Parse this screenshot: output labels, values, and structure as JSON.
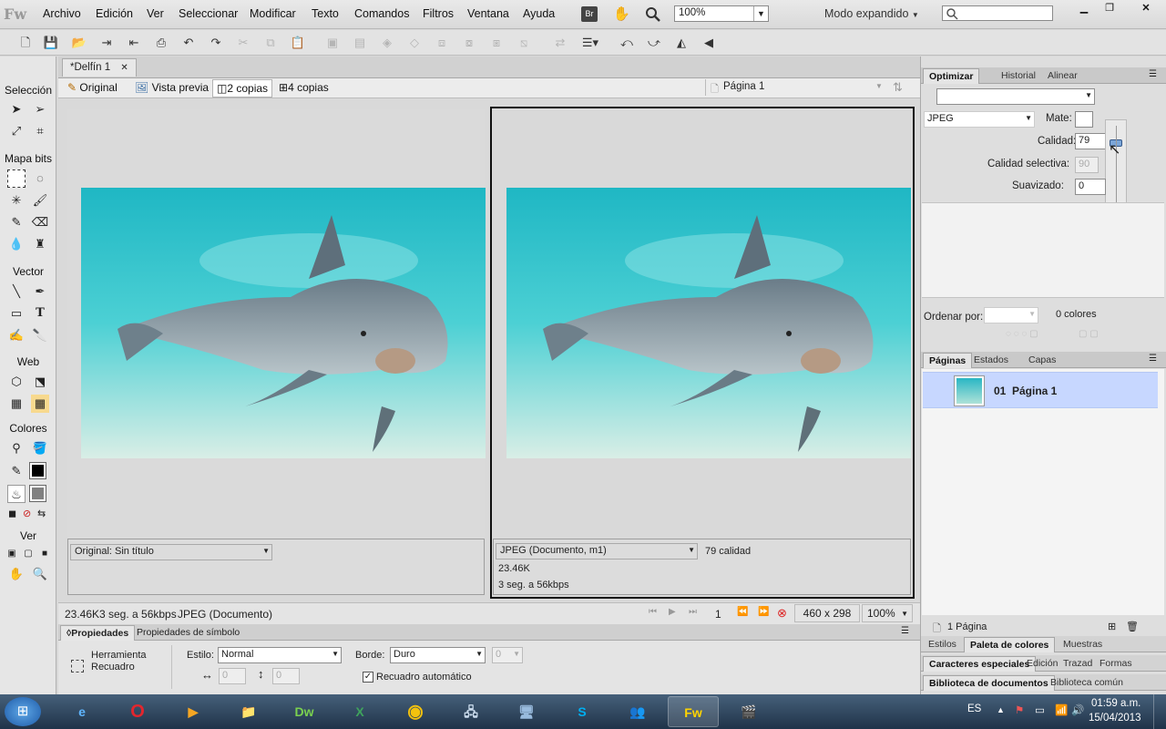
{
  "app": {
    "logo": "Fw"
  },
  "menu": [
    "Archivo",
    "Edición",
    "Ver",
    "Seleccionar",
    "Modificar",
    "Texto",
    "Comandos",
    "Filtros",
    "Ventana",
    "Ayuda"
  ],
  "menubar": {
    "bridge_label": "Br",
    "zoom": "100%",
    "workspace": "Modo expandido"
  },
  "document": {
    "tab_title": "*Delfín 1"
  },
  "view_tabs": {
    "original": "Original",
    "preview": "Vista previa",
    "two_up": "2 copias",
    "four_up": "4 copias",
    "page": "Página 1"
  },
  "tools": {
    "selection": "Selección",
    "bitmap": "Mapa bits",
    "vector": "Vector",
    "web": "Web",
    "colors": "Colores",
    "view": "Ver",
    "stroke_color": "#000000",
    "fill_color": "#808080"
  },
  "left_pane": {
    "format": "Original: Sin título"
  },
  "right_pane": {
    "format": "JPEG (Documento, m1)",
    "quality": "79 calidad",
    "size": "23.46K",
    "time": "3 seg. a 56kbps"
  },
  "status": {
    "size": "23.46K",
    "time": "3 seg. a 56kbps",
    "format": "JPEG (Documento)",
    "page_num": "1",
    "dimensions": "460 x 298",
    "zoom": "100%"
  },
  "properties": {
    "tab1": "Propiedades",
    "tab2": "Propiedades de símbolo",
    "tool_name1": "Herramienta",
    "tool_name2": "Recuadro",
    "style_label": "Estilo:",
    "style_value": "Normal",
    "edge_label": "Borde:",
    "edge_value": "Duro",
    "edge_amount": "0",
    "width": "0",
    "height": "0",
    "auto_crop": "Recuadro automático"
  },
  "optimize": {
    "tabs": [
      "Optimizar",
      "Historial",
      "Alinear"
    ],
    "preset": "",
    "format": "JPEG",
    "matte_label": "Mate:",
    "quality_label": "Calidad:",
    "quality": "79",
    "selective_label": "Calidad selectiva:",
    "selective": "90",
    "smoothing_label": "Suavizado:",
    "smoothing": "0",
    "sort_label": "Ordenar por:",
    "sort_value": "",
    "colors": "0 colores"
  },
  "pages_panel": {
    "tabs": [
      "Páginas",
      "Estados",
      "Capas"
    ],
    "page_number": "01",
    "page_name": "Página 1",
    "count": "1 Página"
  },
  "bottom_panels": {
    "row1": [
      "Estilos",
      "Paleta de colores",
      "Muestras"
    ],
    "row2": [
      "Caracteres especiales",
      "Edición",
      "Trazad",
      "Formas"
    ],
    "row3": [
      "Biblioteca de documentos",
      "Biblioteca común"
    ]
  },
  "taskbar": {
    "lang": "ES",
    "time": "01:59 a.m.",
    "date": "15/04/2013",
    "apps": [
      "Internet Explorer",
      "Opera",
      "Media Player",
      "Explorador",
      "Dreamweaver",
      "Excel",
      "Chrome",
      "Red",
      "Remoto",
      "Skype",
      "Messenger",
      "Fireworks",
      "Hypercam"
    ]
  },
  "colors": {
    "accent": "#3a6ea5",
    "selected_row": "#c7d7ff",
    "taskbar": "#2c4560"
  }
}
